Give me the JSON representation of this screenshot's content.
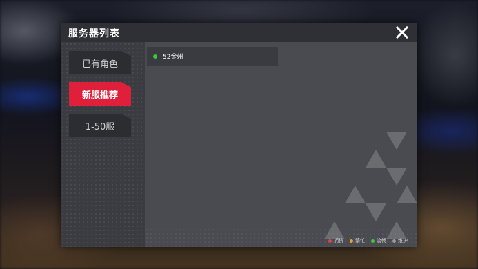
{
  "dialog": {
    "title": "服务器列表",
    "close_icon": "close-x-icon"
  },
  "sidebar": {
    "tabs": [
      {
        "label": "已有角色",
        "active": false
      },
      {
        "label": "新服推荐",
        "active": true
      },
      {
        "label": "1-50服",
        "active": false
      }
    ]
  },
  "servers": [
    {
      "name": "52金州",
      "status": "smooth",
      "status_color": "#3cc83c"
    }
  ],
  "legend": [
    {
      "label": "拥挤",
      "color": "#e04848"
    },
    {
      "label": "繁忙",
      "color": "#e8a030"
    },
    {
      "label": "流畅",
      "color": "#3cc83c"
    },
    {
      "label": "维护",
      "color": "#9a9a9e"
    }
  ],
  "colors": {
    "accent": "#e0203a"
  }
}
